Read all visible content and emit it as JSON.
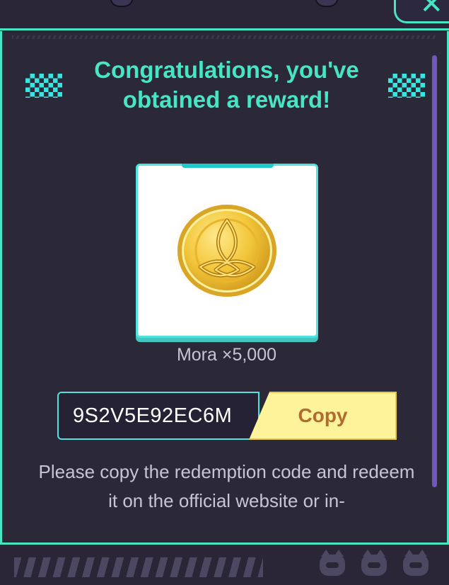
{
  "header": {
    "close_icon": "close-x-icon"
  },
  "dialog": {
    "title_line1": "Congratulations, you've",
    "title_line2": "obtained a reward!",
    "reward": {
      "name": "Mora ×5,000",
      "icon": "mora-coin-icon"
    },
    "code": "9S2V5E92EC6M",
    "copy_label": "Copy",
    "instructions": "Please copy the redemption code and redeem it on the official website or in-"
  },
  "colors": {
    "accent": "#46e5c4",
    "background": "#2b2838",
    "copy_button": "#fdf39a",
    "copy_text": "#b16b2e",
    "scrollbar": "#6f58b8"
  }
}
